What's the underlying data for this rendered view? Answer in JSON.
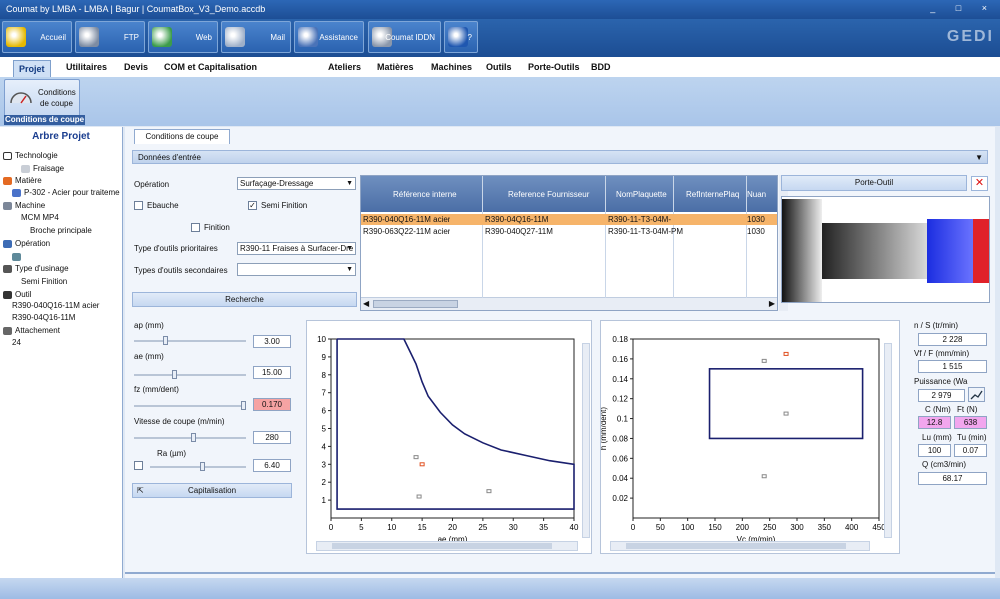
{
  "window": {
    "title": "Coumat by LMBA - LMBA | Bagur | CoumatBox_V3_Demo.accdb",
    "controls": "_ □ ×"
  },
  "toolbar": {
    "buttons": [
      {
        "label": "Accueil",
        "icon": "home-icon",
        "color": "#e6b800"
      },
      {
        "label": "FTP",
        "icon": "server-icon",
        "color": "#7d8ca3"
      },
      {
        "label": "Web",
        "icon": "globe-icon",
        "color": "#3c9c4a"
      },
      {
        "label": "Mail",
        "icon": "mail-icon",
        "color": "#9fb0c9"
      },
      {
        "label": "Assistance",
        "icon": "assistance-icon",
        "color": "#4a73b8"
      },
      {
        "label": "Coumat IDDN",
        "icon": "iddn-icon",
        "color": "#8a97ab"
      },
      {
        "label": "?",
        "icon": "help-icon",
        "color": "#1f57b0"
      }
    ],
    "brand": "GEDI"
  },
  "menu": {
    "items": [
      "Projet",
      "Utilitaires",
      "Devis",
      "COM et Capitalisation",
      "Ateliers",
      "Matières",
      "Machines",
      "Outils",
      "Porte-Outils",
      "BDD"
    ]
  },
  "ribbon": {
    "button_label_1": "Conditions",
    "button_label_2": "de coupe",
    "group_caption": "Conditions de coupe"
  },
  "tree": {
    "title": "Arbre Projet",
    "items": [
      {
        "label": "Technologie",
        "level": 0,
        "icon": "technologie-icon"
      },
      {
        "label": "Fraisage",
        "level": 2,
        "icon": "fraisage-icon"
      },
      {
        "label": "Matière",
        "level": 0,
        "icon": "matiere-icon"
      },
      {
        "label": "P-302 - Acier pour traiteme",
        "level": 1,
        "icon": "material-icon"
      },
      {
        "label": "Machine",
        "level": 0,
        "icon": "machine-icon"
      },
      {
        "label": "MCM MP4",
        "level": 2,
        "icon": ""
      },
      {
        "label": "Broche principale",
        "level": 3,
        "icon": ""
      },
      {
        "label": "Opération",
        "level": 0,
        "icon": "operation-icon"
      },
      {
        "label": "",
        "level": 1,
        "icon": "op-tool-icon"
      },
      {
        "label": "Type d'usinage",
        "level": 0,
        "icon": "usinage-icon"
      },
      {
        "label": "Semi Finition",
        "level": 2,
        "icon": ""
      },
      {
        "label": "Outil",
        "level": 0,
        "icon": "outil-icon"
      },
      {
        "label": "R390-040Q16-11M acier",
        "level": 1,
        "icon": ""
      },
      {
        "label": "R390-04Q16-11M",
        "level": 1,
        "icon": ""
      },
      {
        "label": "Attachement",
        "level": 0,
        "icon": "attachement-icon"
      },
      {
        "label": "24",
        "level": 1,
        "icon": ""
      }
    ]
  },
  "tab": {
    "label": "Conditions de coupe"
  },
  "section": {
    "label": "Données d'entrée"
  },
  "form": {
    "operation_label": "Opération",
    "operation_value": "Surfaçage-Dressage",
    "ebauche_label": "Ebauche",
    "ebauche_checked": false,
    "semi_finition_label": "Semi Finition",
    "semi_finition_checked": true,
    "finition_label": "Finition",
    "finition_checked": false,
    "type_prio_label": "Type d'outils prioritaires",
    "type_prio_value": "R390-11 Fraises à Surfacer-Dre",
    "type_sec_label": "Types d'outils secondaires",
    "type_sec_value": "",
    "search_button": "Recherche"
  },
  "grid": {
    "columns": [
      "Référence interne",
      "Reference Fournisseur",
      "NomPlaquette",
      "RefInternePlaq",
      "Nuan"
    ],
    "rows": [
      [
        "R390-040Q16-11M acier",
        "R390-04Q16-11M",
        "R390-11-T3-04M-",
        "",
        "1030"
      ],
      [
        "R390-063Q22-11M acier",
        "R390-040Q27-11M",
        "R390-11-T3-04M-PM",
        "",
        "1030"
      ]
    ]
  },
  "porte_outil": {
    "button": "Porte-Outil"
  },
  "params": {
    "ap_label": "ap (mm)",
    "ap_value": "3.00",
    "ae_label": "ae (mm)",
    "ae_value": "15.00",
    "fz_label": "fz (mm/dent)",
    "fz_value": "0.170",
    "vc_label": "Vitesse de coupe (m/min)",
    "vc_value": "280",
    "ra_label": "Ra (µm)",
    "ra_value": "6.40",
    "capitalisation": "Capitalisation",
    "alert_color": "#f6a3a3"
  },
  "results": {
    "n_label": "n / S (tr/min)",
    "n_value": "2 228",
    "vf_label": "Vf / F (mm/min)",
    "vf_value": "1 515",
    "p_label": "Puissance (Wa",
    "p_value": "2 979",
    "c_label": "C (Nm)",
    "c_value": "12.8",
    "ft_label": "Ft (N)",
    "ft_value": "638",
    "lu_label": "Lu (mm)",
    "lu_value": "100",
    "tu_label": "Tu (min)",
    "tu_value": "0.07",
    "q_label": "Q (cm3/min)",
    "q_value": "68.17",
    "pink_color": "#f2a6ee"
  },
  "chart_data": [
    {
      "type": "line",
      "xlabel": "ae (mm)",
      "ylabel": "ap (mm)",
      "xlim": [
        0,
        40
      ],
      "ylim": [
        0,
        10
      ],
      "x_ticks": [
        0,
        5,
        10,
        15,
        20,
        25,
        30,
        35,
        40
      ],
      "y_ticks": [
        1,
        2,
        3,
        4,
        5,
        6,
        7,
        8,
        9,
        10
      ],
      "boundary": [
        [
          1,
          10
        ],
        [
          12,
          10
        ],
        [
          13,
          9.3
        ],
        [
          14,
          8.6
        ],
        [
          15,
          7.6
        ],
        [
          16,
          6.8
        ],
        [
          18,
          5.9
        ],
        [
          20,
          5.2
        ],
        [
          22,
          4.7
        ],
        [
          25,
          4.2
        ],
        [
          28,
          3.8
        ],
        [
          32,
          3.5
        ],
        [
          36,
          3.2
        ],
        [
          40,
          3.0
        ],
        [
          40,
          0.5
        ],
        [
          1,
          0.5
        ],
        [
          1,
          10
        ]
      ],
      "points": [
        {
          "x": 14,
          "y": 3.4,
          "color": "#888888"
        },
        {
          "x": 15,
          "y": 3.0,
          "color": "#e05020"
        },
        {
          "x": 14.5,
          "y": 1.2,
          "color": "#888888"
        },
        {
          "x": 26,
          "y": 1.5,
          "color": "#888888"
        }
      ]
    },
    {
      "type": "scatter",
      "xlabel": "Vc (m/min)",
      "ylabel": "h (mm/dent)",
      "xlim": [
        0,
        450
      ],
      "ylim": [
        0,
        0.18
      ],
      "x_ticks": [
        0,
        50,
        100,
        150,
        200,
        250,
        300,
        350,
        400,
        450
      ],
      "y_ticks": [
        0.02,
        0.04,
        0.06,
        0.08,
        0.1,
        0.12,
        0.14,
        0.16,
        0.18
      ],
      "box": {
        "x0": 140,
        "x1": 420,
        "y0": 0.08,
        "y1": 0.15
      },
      "points": [
        {
          "x": 240,
          "y": 0.158,
          "color": "#888888"
        },
        {
          "x": 280,
          "y": 0.165,
          "color": "#e05020"
        },
        {
          "x": 280,
          "y": 0.105,
          "color": "#888888"
        },
        {
          "x": 240,
          "y": 0.042,
          "color": "#888888"
        }
      ]
    }
  ]
}
